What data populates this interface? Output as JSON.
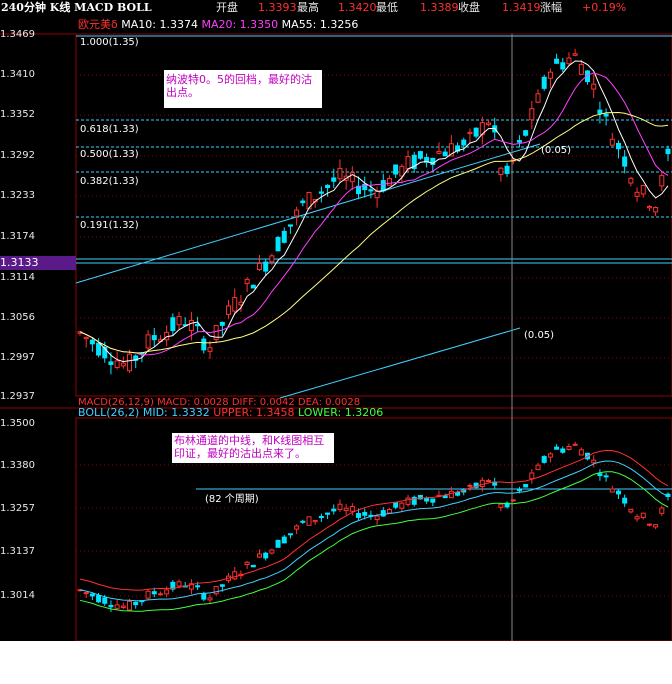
{
  "header": {
    "title": "240分钟 K线 MACD BOLL",
    "open_label": "开盘",
    "open_value": "1.3393",
    "high_label": "最高",
    "high_value": "1.3420",
    "low_label": "最低",
    "low_value": "1.3389",
    "close_label": "收盘",
    "close_value": "1.3419",
    "change_label": "涨幅",
    "change_value": "+0.19%"
  },
  "main_panel": {
    "instrument": "欧元美δ",
    "ma10_label": "MA10: 1.3374",
    "ma20_label": "MA20: 1.3350",
    "ma55_label": "MA55: 1.3256",
    "y_ticks": [
      "1.3469",
      "1.3410",
      "1.3352",
      "1.3292",
      "1.3233",
      "1.3174",
      "1.3114",
      "1.3056",
      "1.2997",
      "1.2937"
    ],
    "highlight_price": "1.3133",
    "fib_levels": [
      "1.000(1.35)",
      "0.618(1.33)",
      "0.500(1.33)",
      "0.382(1.33)",
      "0.191(1.32)"
    ],
    "annotation_fib": "(0.05)",
    "annotation_cursor": "(0.05)",
    "note": "纳波特0。5的回档，最好的沽出点。"
  },
  "boll_panel": {
    "legend": "BOLL(26,2) MID: 1.3332",
    "upper_label": "UPPER: 1.3458",
    "lower_label": "LOWER: 1.3206",
    "y_ticks": [
      "1.3500",
      "1.3380",
      "1.3257",
      "1.3137",
      "1.3014"
    ],
    "period_label": "(82 个周期)",
    "note": "布林通道的中线，和K线图相互印证，最好的沽出点来了。"
  },
  "macd_legend": "MACD(26,12,9) MACD: 0.0028 DIFF: 0.0042 DEA: 0.0028",
  "colors": {
    "up": "#ff3030",
    "down": "#00e5ff",
    "ma10": "#ffffff",
    "ma20": "#ff40ff",
    "ma55": "#ffff80",
    "boll_mid": "#40d0ff",
    "boll_upper": "#ff3030",
    "boll_lower": "#40ff40",
    "grid": "#800000",
    "highlight": "#5a1a8a"
  }
}
